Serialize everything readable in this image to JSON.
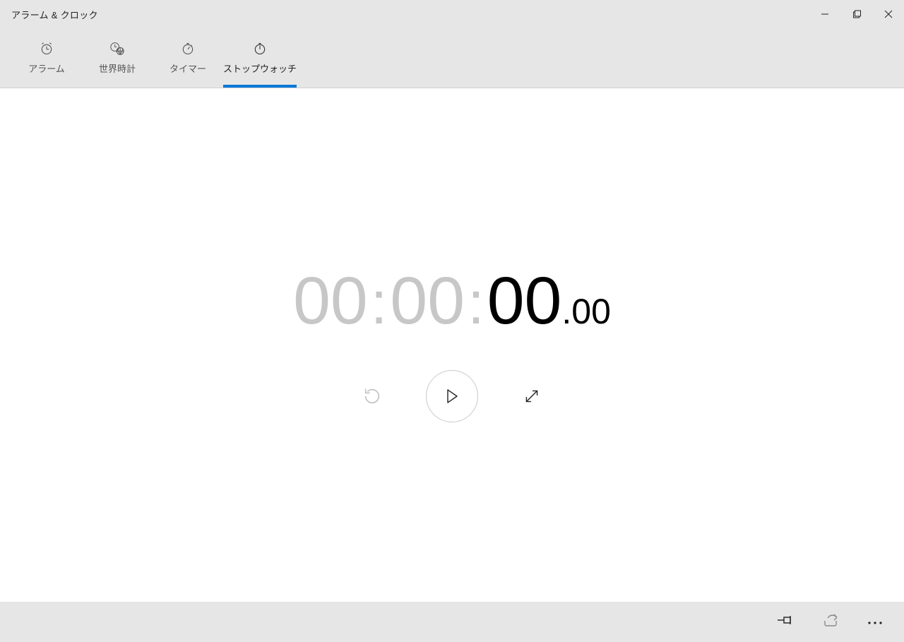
{
  "app": {
    "title": "アラーム & クロック"
  },
  "tabs": {
    "alarm": {
      "label": "アラーム",
      "icon": "alarm-clock-icon"
    },
    "world": {
      "label": "世界時計",
      "icon": "globe-clock-icon"
    },
    "timer": {
      "label": "タイマー",
      "icon": "timer-icon"
    },
    "stopwatch": {
      "label": "ストップウォッチ",
      "icon": "stopwatch-icon",
      "active": true
    }
  },
  "stopwatch": {
    "hours": "00",
    "minutes": "00",
    "seconds": "00",
    "hundredths": "00",
    "colon": ":",
    "dot": "."
  },
  "controls": {
    "reset": "reset",
    "play": "start",
    "expand": "expand"
  },
  "bottom": {
    "pin": "pin",
    "share": "share",
    "more": "more"
  }
}
